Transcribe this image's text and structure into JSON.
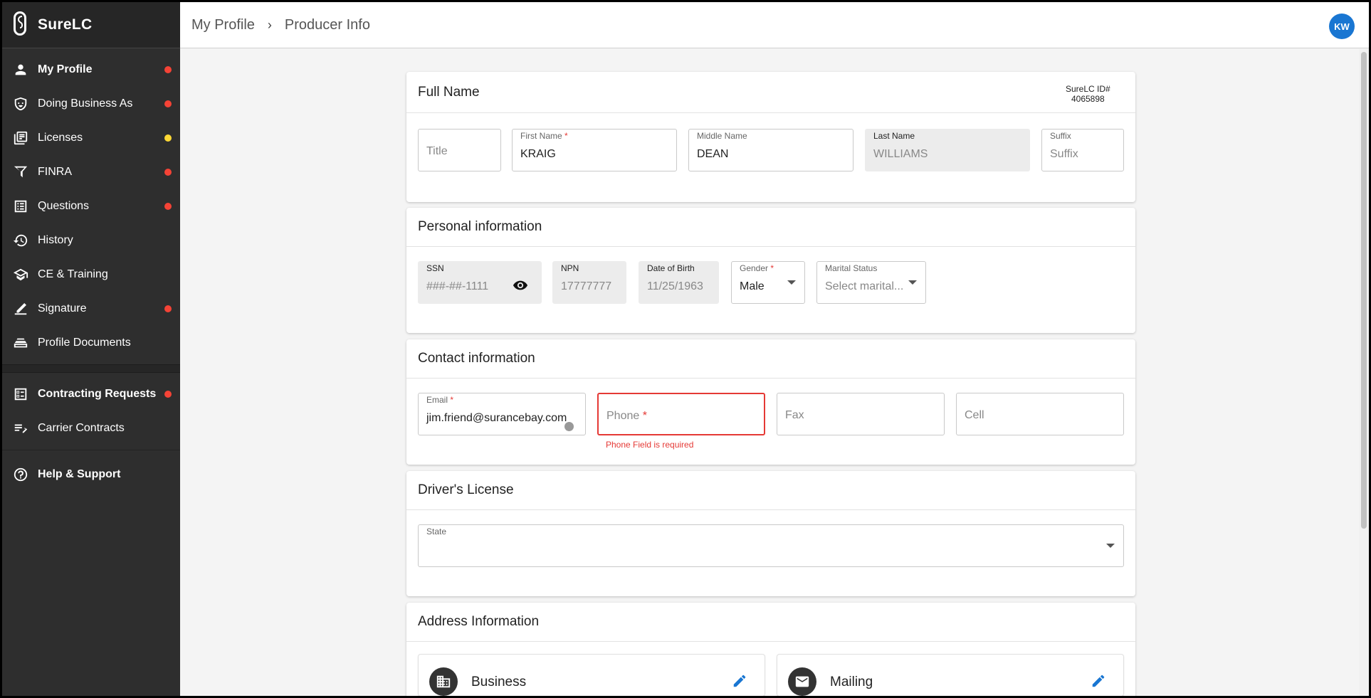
{
  "brand": {
    "name": "SureLC"
  },
  "sidebar": {
    "items": [
      {
        "label": "My Profile",
        "icon": "person-icon",
        "bold": true,
        "dot": "red"
      },
      {
        "label": "Doing Business As",
        "icon": "mask-icon",
        "bold": false,
        "dot": "red"
      },
      {
        "label": "Licenses",
        "icon": "licenses-icon",
        "bold": false,
        "dot": "yellow"
      },
      {
        "label": "FINRA",
        "icon": "finra-icon",
        "bold": false,
        "dot": "red"
      },
      {
        "label": "Questions",
        "icon": "list-icon",
        "bold": false,
        "dot": "red"
      },
      {
        "label": "History",
        "icon": "history-icon",
        "bold": false,
        "dot": ""
      },
      {
        "label": "CE & Training",
        "icon": "school-icon",
        "bold": false,
        "dot": ""
      },
      {
        "label": "Signature",
        "icon": "signature-icon",
        "bold": false,
        "dot": "red"
      },
      {
        "label": "Profile Documents",
        "icon": "documents-icon",
        "bold": false,
        "dot": ""
      }
    ],
    "contracting": [
      {
        "label": "Contracting Requests",
        "icon": "checklist-icon",
        "bold": true,
        "dot": "red"
      },
      {
        "label": "Carrier Contracts",
        "icon": "edit-note-icon",
        "bold": false,
        "dot": ""
      }
    ],
    "help": {
      "label": "Help & Support",
      "icon": "help-icon"
    }
  },
  "header": {
    "crumb1": "My Profile",
    "crumb2": "Producer Info",
    "avatar": "KW"
  },
  "full_name": {
    "title": "Full Name",
    "id_label": "SureLC ID#",
    "id_value": "4065898",
    "title_placeholder": "Title",
    "first_label": "First Name",
    "first_value": "KRAIG",
    "middle_label": "Middle Name",
    "middle_value": "DEAN",
    "last_label": "Last Name",
    "last_value": "WILLIAMS",
    "suffix_label": "Suffix",
    "suffix_placeholder": "Suffix"
  },
  "personal": {
    "title": "Personal information",
    "ssn_label": "SSN",
    "ssn_value": "###-##-1111",
    "npn_label": "NPN",
    "npn_value": "17777777",
    "dob_label": "Date of Birth",
    "dob_value": "11/25/1963",
    "gender_label": "Gender",
    "gender_value": "Male",
    "marital_label": "Marital Status",
    "marital_placeholder": "Select marital..."
  },
  "contact": {
    "title": "Contact information",
    "email_label": "Email",
    "email_value": "jim.friend@surancebay.com",
    "phone_placeholder": "Phone",
    "phone_error": "Phone Field is required",
    "fax_placeholder": "Fax",
    "cell_placeholder": "Cell"
  },
  "license": {
    "title": "Driver's License",
    "state_label": "State"
  },
  "address": {
    "title": "Address Information",
    "business": "Business",
    "mailing": "Mailing"
  },
  "colors": {
    "sidebar_bg": "#2e2e2e",
    "accent": "#1976d2",
    "error": "#e53935",
    "dot_red": "#f44336",
    "dot_yellow": "#fdd835"
  }
}
